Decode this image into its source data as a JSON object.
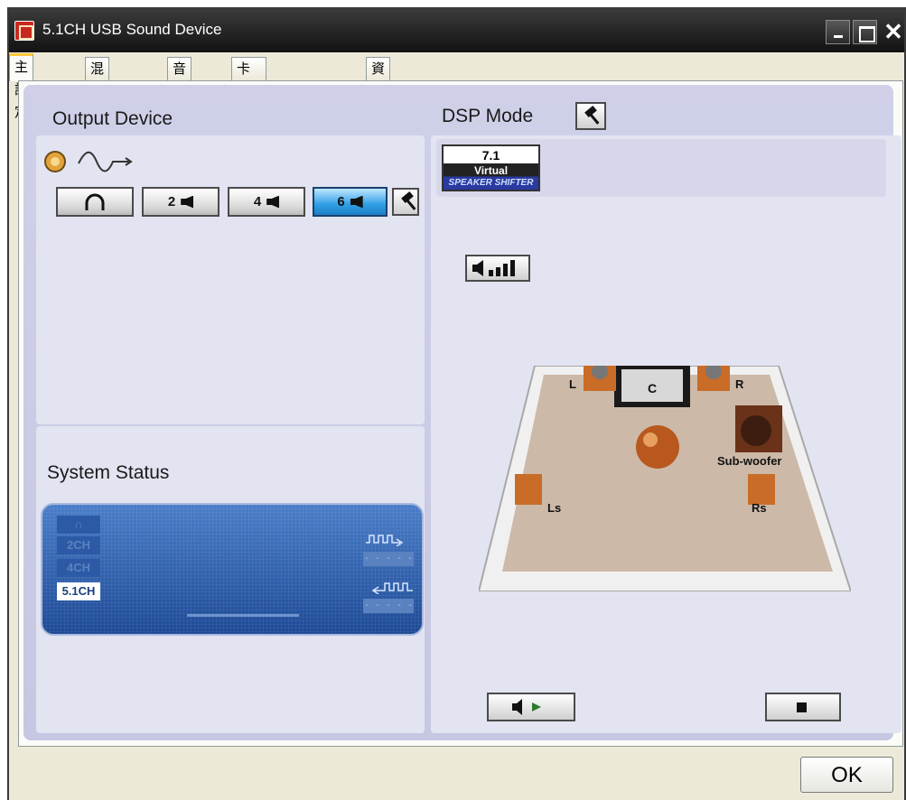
{
  "window": {
    "title": "5.1CH USB Sound Device"
  },
  "tabs": [
    {
      "label": "主設定",
      "active": true
    },
    {
      "label": "混音音量",
      "active": false
    },
    {
      "label": "音效",
      "active": false
    },
    {
      "label": "卡拉OK/魔音器",
      "active": false
    },
    {
      "label": "資訊",
      "active": false
    }
  ],
  "output_device": {
    "title": "Output Device",
    "buttons": [
      {
        "label": "",
        "icon": "headphone-icon",
        "active": false
      },
      {
        "label": "2",
        "icon": "speaker-icon",
        "active": false
      },
      {
        "label": "4",
        "icon": "speaker-icon",
        "active": false
      },
      {
        "label": "6",
        "icon": "speaker-icon",
        "active": true
      }
    ]
  },
  "dsp_mode": {
    "title": "DSP Mode",
    "chip": {
      "line1": "7.1",
      "line2": "Virtual",
      "line3": "SPEAKER SHIFTER"
    }
  },
  "system_status": {
    "title": "System Status",
    "channels": [
      "2CH",
      "4CH",
      "5.1CH"
    ],
    "active_channel": "5.1CH"
  },
  "speakers": {
    "front_left": "L",
    "center": "C",
    "front_right": "R",
    "subwoofer": "Sub-woofer",
    "surround_left": "Ls",
    "surround_right": "Rs"
  },
  "footer": {
    "ok_label": "OK"
  },
  "colors": {
    "panel_bg": "#c6c7e2",
    "lcd_bg": "#1d4a95",
    "active_button": "#2f9fe6"
  }
}
